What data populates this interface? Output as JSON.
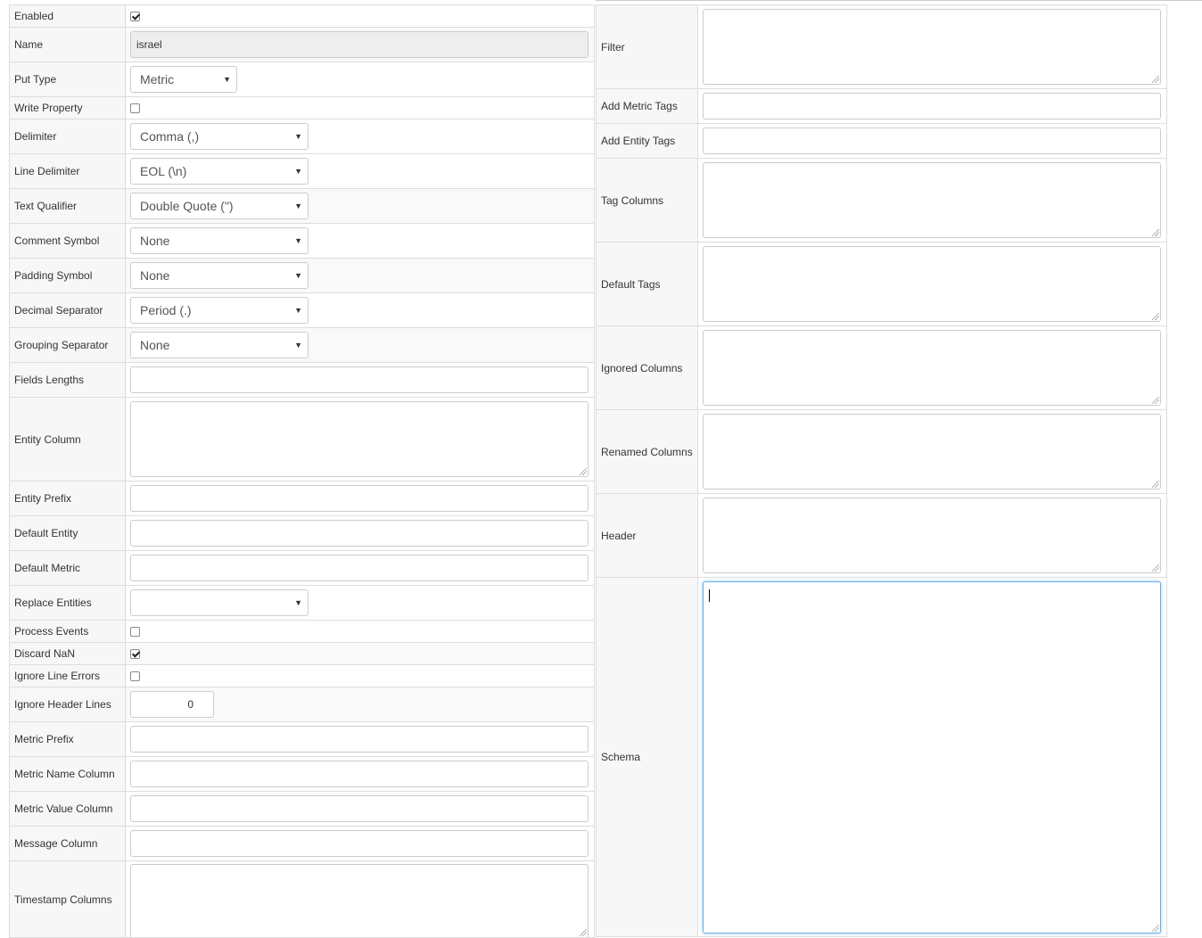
{
  "left_fields": {
    "enabled": {
      "label": "Enabled",
      "checked": true
    },
    "name": {
      "label": "Name",
      "value": "israel"
    },
    "put_type": {
      "label": "Put Type",
      "value": "Metric"
    },
    "write_property": {
      "label": "Write Property",
      "checked": false
    },
    "delimiter": {
      "label": "Delimiter",
      "value": "Comma (,)"
    },
    "line_delimiter": {
      "label": "Line Delimiter",
      "value": "EOL (\\n)"
    },
    "text_qualifier": {
      "label": "Text Qualifier",
      "value": "Double Quote (\")"
    },
    "comment_symbol": {
      "label": "Comment Symbol",
      "value": "None"
    },
    "padding_symbol": {
      "label": "Padding Symbol",
      "value": "None"
    },
    "decimal_separator": {
      "label": "Decimal Separator",
      "value": "Period (.)"
    },
    "grouping_separator": {
      "label": "Grouping Separator",
      "value": "None"
    },
    "fields_lengths": {
      "label": "Fields Lengths",
      "value": ""
    },
    "entity_column": {
      "label": "Entity Column",
      "value": ""
    },
    "entity_prefix": {
      "label": "Entity Prefix",
      "value": ""
    },
    "default_entity": {
      "label": "Default Entity",
      "value": ""
    },
    "default_metric": {
      "label": "Default Metric",
      "value": ""
    },
    "replace_entities": {
      "label": "Replace Entities",
      "value": ""
    },
    "process_events": {
      "label": "Process Events",
      "checked": false
    },
    "discard_nan": {
      "label": "Discard NaN",
      "checked": true
    },
    "ignore_line_errors": {
      "label": "Ignore Line Errors",
      "checked": false
    },
    "ignore_header_lines": {
      "label": "Ignore Header Lines",
      "value": "0"
    },
    "metric_prefix": {
      "label": "Metric Prefix",
      "value": ""
    },
    "metric_name_column": {
      "label": "Metric Name Column",
      "value": ""
    },
    "metric_value_column": {
      "label": "Metric Value Column",
      "value": ""
    },
    "message_column": {
      "label": "Message Column",
      "value": ""
    },
    "timestamp_columns": {
      "label": "Timestamp Columns",
      "value": ""
    }
  },
  "right_fields": {
    "filter": {
      "label": "Filter",
      "value": ""
    },
    "add_metric_tags": {
      "label": "Add Metric Tags",
      "value": ""
    },
    "add_entity_tags": {
      "label": "Add Entity Tags",
      "value": ""
    },
    "tag_columns": {
      "label": "Tag Columns",
      "value": ""
    },
    "default_tags": {
      "label": "Default Tags",
      "value": ""
    },
    "ignored_columns": {
      "label": "Ignored Columns",
      "value": ""
    },
    "renamed_columns": {
      "label": "Renamed Columns",
      "value": ""
    },
    "header": {
      "label": "Header",
      "value": ""
    },
    "schema": {
      "label": "Schema",
      "value": ""
    }
  },
  "icons": {
    "select_arrow": "▼"
  },
  "colors": {
    "focus_border": "#66afe9",
    "label_bg": "#f7f7f7",
    "border": "#dddddd"
  }
}
